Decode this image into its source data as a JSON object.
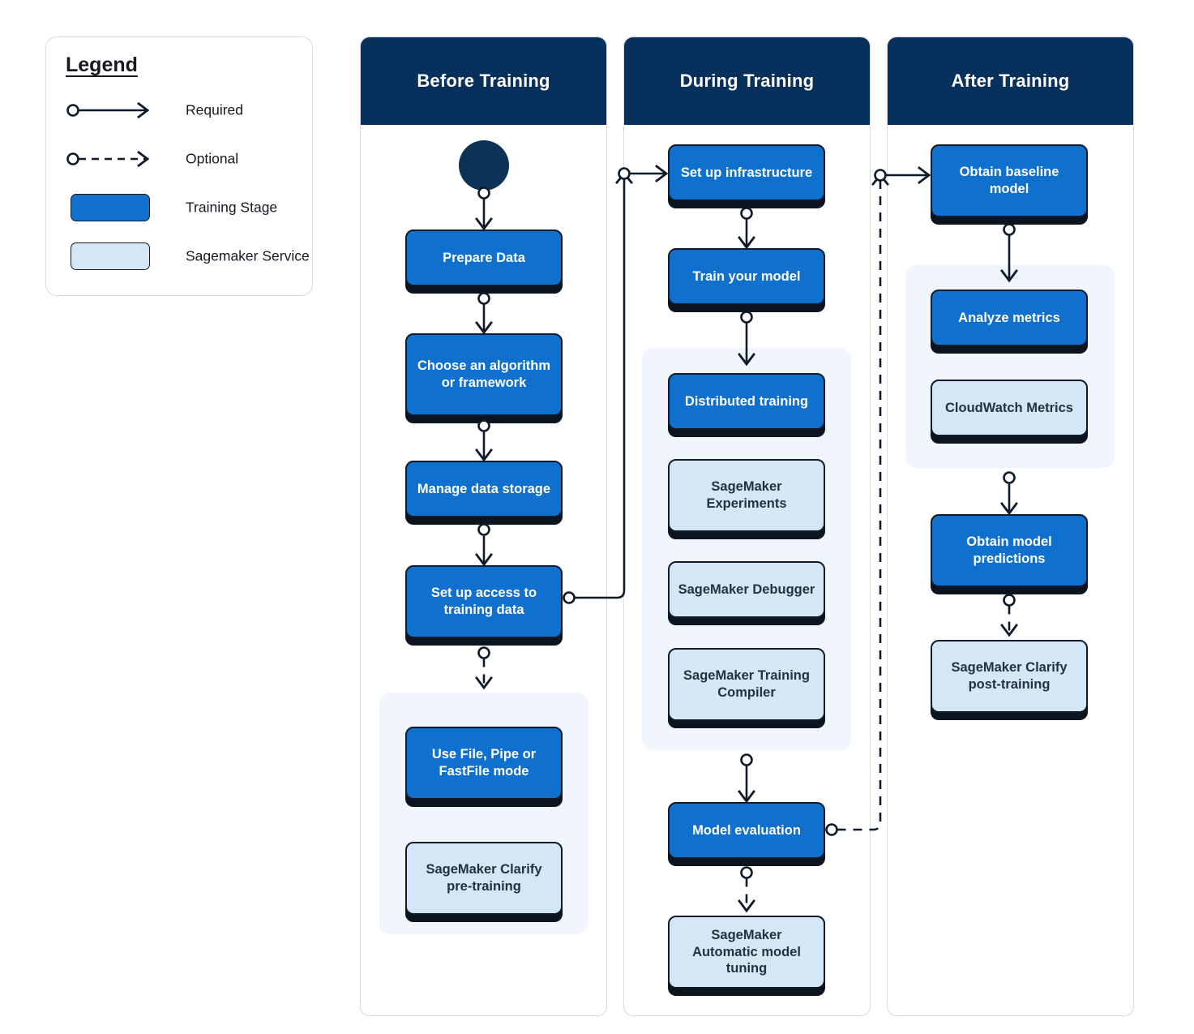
{
  "legend": {
    "title": "Legend",
    "rows": [
      {
        "icon": "solid-arrow-icon",
        "label": "Required"
      },
      {
        "icon": "dashed-arrow-icon",
        "label": "Optional"
      },
      {
        "icon": "blue-swatch-icon",
        "label": "Training Stage",
        "color": "#1070ce"
      },
      {
        "icon": "light-blue-swatch-icon",
        "label": "Sagemaker Service",
        "color": "#d4e7f7"
      }
    ]
  },
  "colors": {
    "header_navy": "#08305c",
    "training_stage": "#1070ce",
    "sagemaker_service": "#d4e7f7",
    "service_group_bg": "#f1f6fd",
    "outline": "#0f1b2a",
    "start_node": "#0c3258"
  },
  "columns": [
    {
      "id": "before-training",
      "title": "Before Training",
      "nodes": [
        {
          "id": "start",
          "type": "start",
          "label": ""
        },
        {
          "id": "prepare-data",
          "type": "stage",
          "label": "Prepare Data"
        },
        {
          "id": "choose-algorithm",
          "type": "stage",
          "label": "Choose an algorithm or framework"
        },
        {
          "id": "manage-data-storage",
          "type": "stage",
          "label": "Manage data storage"
        },
        {
          "id": "set-up-access",
          "type": "stage",
          "label": "Set up access to training data"
        },
        {
          "id": "file-pipe-fastfile",
          "type": "stage",
          "label": "Use File, Pipe or FastFile mode",
          "group": "svc-before"
        },
        {
          "id": "clarify-pre-training",
          "type": "service",
          "label": "SageMaker Clarify pre-training",
          "group": "svc-before"
        }
      ]
    },
    {
      "id": "during-training",
      "title": "During Training",
      "nodes": [
        {
          "id": "set-up-infrastructure",
          "type": "stage",
          "label": "Set up infrastructure"
        },
        {
          "id": "train-your-model",
          "type": "stage",
          "label": "Train your model"
        },
        {
          "id": "distributed-training",
          "type": "stage",
          "label": "Distributed training",
          "group": "svc-during"
        },
        {
          "id": "sagemaker-experiments",
          "type": "service",
          "label": "SageMaker Experiments",
          "group": "svc-during"
        },
        {
          "id": "sagemaker-debugger",
          "type": "service",
          "label": "SageMaker Debugger",
          "group": "svc-during"
        },
        {
          "id": "sagemaker-training-compiler",
          "type": "service",
          "label": "SageMaker Training Compiler",
          "group": "svc-during"
        },
        {
          "id": "model-evaluation",
          "type": "stage",
          "label": "Model evaluation"
        },
        {
          "id": "automatic-model-tuning",
          "type": "service",
          "label": "SageMaker Automatic model tuning"
        }
      ]
    },
    {
      "id": "after-training",
      "title": "After Training",
      "nodes": [
        {
          "id": "obtain-baseline-model",
          "type": "stage",
          "label": "Obtain baseline model"
        },
        {
          "id": "analyze-metrics",
          "type": "stage",
          "label": "Analyze metrics",
          "group": "svc-after"
        },
        {
          "id": "cloudwatch-metrics",
          "type": "service",
          "label": "CloudWatch Metrics",
          "group": "svc-after"
        },
        {
          "id": "obtain-model-predictions",
          "type": "stage",
          "label": "Obtain model predictions"
        },
        {
          "id": "clarify-post-training",
          "type": "service",
          "label": "SageMaker Clarify post-training"
        }
      ]
    }
  ],
  "edges": [
    {
      "from": "start",
      "to": "prepare-data",
      "style": "required"
    },
    {
      "from": "prepare-data",
      "to": "choose-algorithm",
      "style": "required"
    },
    {
      "from": "choose-algorithm",
      "to": "manage-data-storage",
      "style": "required"
    },
    {
      "from": "manage-data-storage",
      "to": "set-up-access",
      "style": "required"
    },
    {
      "from": "set-up-access",
      "to": "file-pipe-fastfile",
      "style": "optional"
    },
    {
      "from": "set-up-access",
      "to": "set-up-infrastructure",
      "style": "required"
    },
    {
      "from": "set-up-infrastructure",
      "to": "train-your-model",
      "style": "required"
    },
    {
      "from": "train-your-model",
      "to": "distributed-training",
      "style": "required"
    },
    {
      "from": "sagemaker-training-compiler",
      "to": "model-evaluation",
      "style": "required"
    },
    {
      "from": "model-evaluation",
      "to": "automatic-model-tuning",
      "style": "optional"
    },
    {
      "from": "model-evaluation",
      "to": "obtain-baseline-model",
      "style": "optional"
    },
    {
      "from": "obtain-baseline-model",
      "to": "analyze-metrics",
      "style": "required"
    },
    {
      "from": "cloudwatch-metrics",
      "to": "obtain-model-predictions",
      "style": "required"
    },
    {
      "from": "obtain-model-predictions",
      "to": "clarify-post-training",
      "style": "optional"
    }
  ]
}
